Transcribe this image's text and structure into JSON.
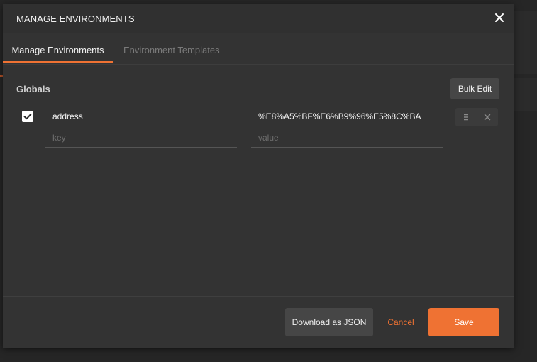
{
  "dialog": {
    "title": "MANAGE ENVIRONMENTS"
  },
  "tabs": [
    {
      "label": "Manage Environments",
      "active": true
    },
    {
      "label": "Environment Templates",
      "active": false
    }
  ],
  "globals": {
    "heading": "Globals",
    "bulk_edit_label": "Bulk Edit",
    "variables": [
      {
        "enabled": true,
        "key": "address",
        "value": "%E8%A5%BF%E6%B9%96%E5%8C%BA"
      }
    ],
    "new_row": {
      "key_placeholder": "key",
      "value_placeholder": "value"
    }
  },
  "footer": {
    "download_label": "Download as JSON",
    "cancel_label": "Cancel",
    "save_label": "Save"
  },
  "colors": {
    "accent": "#ef7233",
    "dialog_bg": "#333333",
    "backdrop": "#262626"
  },
  "icons": {
    "close": "close-icon",
    "checkbox": "checkmark-icon",
    "row_menu": "hamburger-icon",
    "row_delete": "close-icon"
  }
}
